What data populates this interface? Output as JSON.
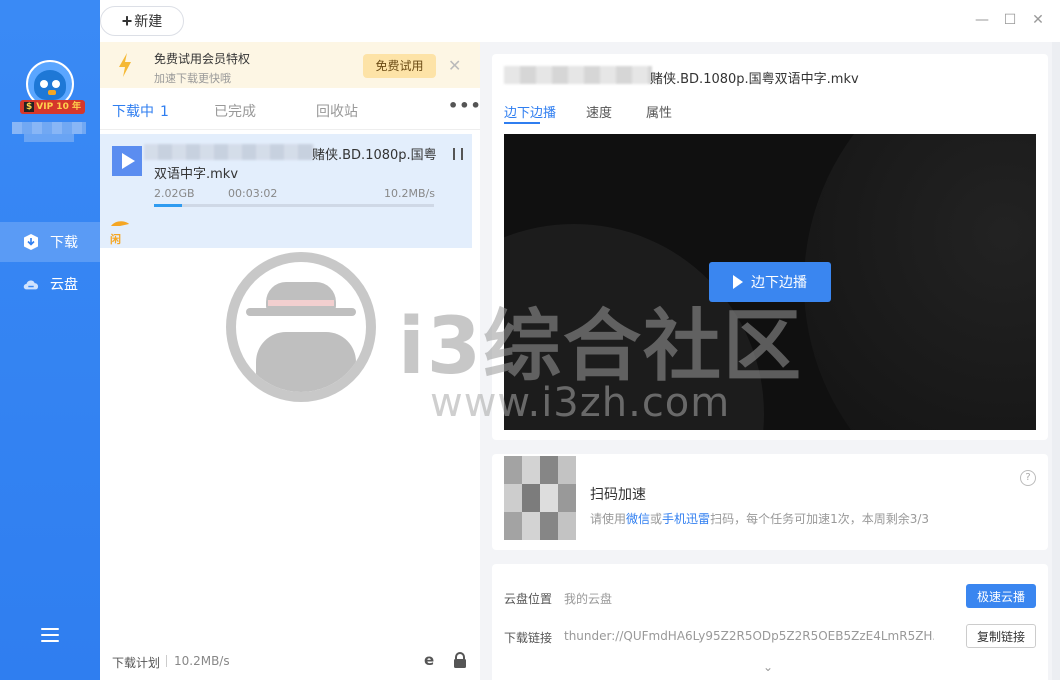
{
  "sidebar": {
    "vip_badge": "VIP 10 年",
    "vip_s": "$",
    "items": [
      {
        "label": "下载",
        "icon": "download-icon",
        "active": true
      },
      {
        "label": "云盘",
        "icon": "cloud-icon",
        "active": false
      }
    ],
    "menu_icon": "menu-icon"
  },
  "topbar": {
    "new_label": "新建",
    "window_controls": [
      "minimize-icon",
      "maximize-icon",
      "close-icon"
    ]
  },
  "promo": {
    "title": "免费试用会员特权",
    "subtitle": "加速下载更快哦",
    "button": "免费试用"
  },
  "tabs": {
    "downloading": "下载中",
    "downloading_count": "1",
    "completed": "已完成",
    "recycle": "回收站",
    "more": "•••"
  },
  "task": {
    "name": "赌侠.BD.1080p.国粤双语中字.mkv",
    "size": "2.02GB",
    "time": "00:03:02",
    "speed": "10.2MB/s",
    "progress": 0.1,
    "accel_label": "闲"
  },
  "bottom": {
    "plan_label": "下载计划",
    "plan_speed": "10.2MB/s"
  },
  "detail": {
    "title": "赌侠.BD.1080p.国粤双语中字.mkv",
    "tabs": [
      "边下边播",
      "速度",
      "属性"
    ],
    "play_button": "边下边播"
  },
  "qr": {
    "title": "扫码加速",
    "desc_prefix": "请使用",
    "wechat": "微信",
    "or": "或",
    "app": "手机迅雷",
    "desc_suffix": "扫码，每个任务可加速1次，本周剩余3/3",
    "help": "?"
  },
  "cloud": {
    "location_label": "云盘位置",
    "location_value": "我的云盘",
    "cloud_button": "极速云播",
    "link_label": "下载链接",
    "link_value": "thunder://QUFmdHA6Ly95Z2R5ODp5Z2R5OEB5ZzE4LmR5ZH...",
    "copy_button": "复制链接"
  },
  "watermark": {
    "text": "i3综合社区",
    "url": "www.i3zh.com"
  },
  "colors": {
    "accent": "#2f7ef0",
    "sidebar": "#3a8af5",
    "promo_bg": "#fdf6e4",
    "task_bg": "#e3eefc"
  }
}
